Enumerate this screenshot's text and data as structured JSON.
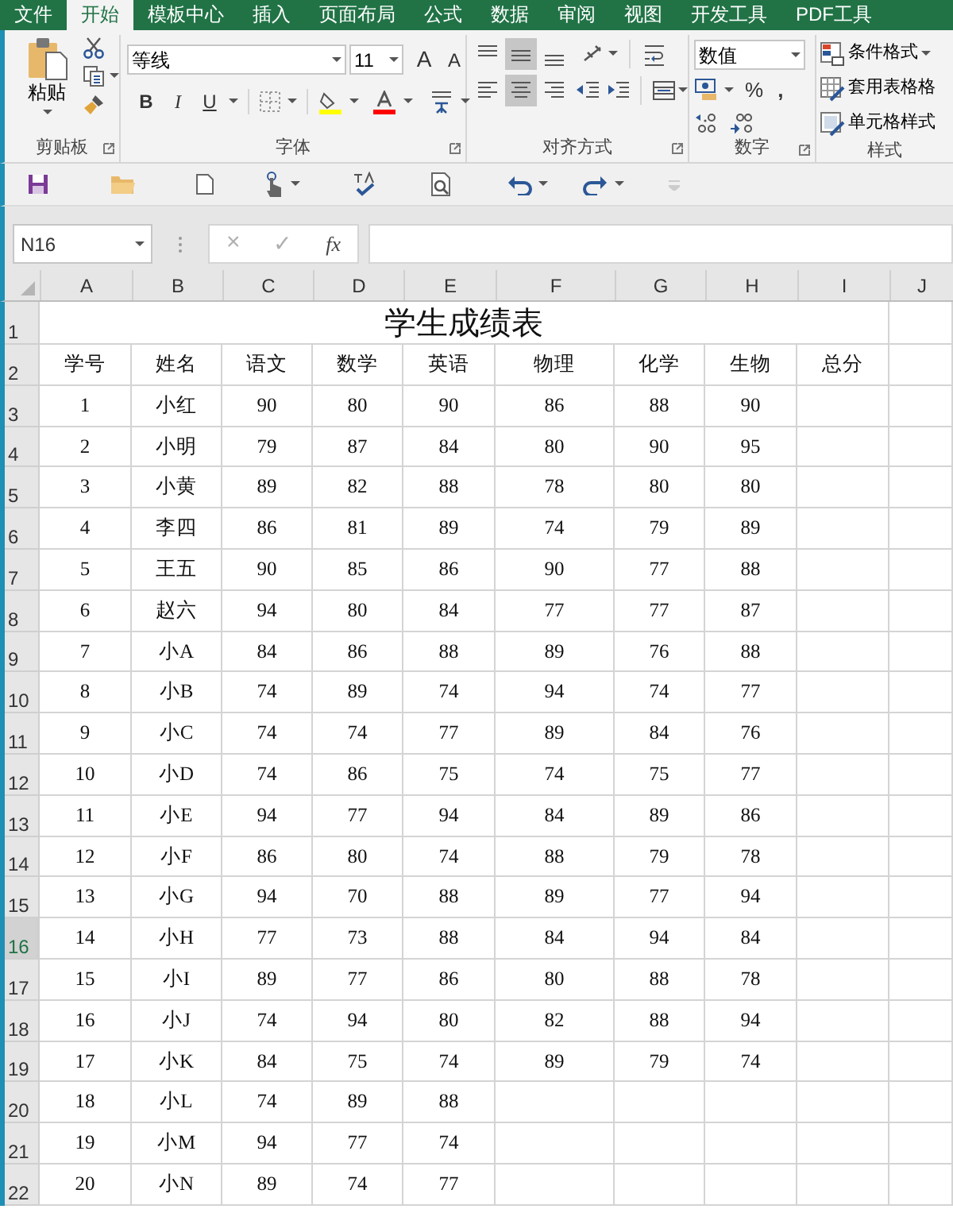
{
  "tabs": [
    {
      "label": "文件",
      "selected": false
    },
    {
      "label": "开始",
      "selected": true
    },
    {
      "label": "模板中心",
      "selected": false
    },
    {
      "label": "插入",
      "selected": false
    },
    {
      "label": "页面布局",
      "selected": false
    },
    {
      "label": "公式",
      "selected": false
    },
    {
      "label": "数据",
      "selected": false
    },
    {
      "label": "审阅",
      "selected": false
    },
    {
      "label": "视图",
      "selected": false
    },
    {
      "label": "开发工具",
      "selected": false
    },
    {
      "label": "PDF工具",
      "selected": false
    }
  ],
  "ribbon": {
    "clipboard": {
      "paste_label": "粘贴",
      "group_label": "剪贴板"
    },
    "font": {
      "font_name": "等线",
      "font_size": "11",
      "grow_label": "A",
      "shrink_label": "A",
      "style_buttons": [
        "B",
        "I",
        "U"
      ],
      "group_label": "字体"
    },
    "alignment": {
      "vertical_align": [
        {
          "selected": false
        },
        {
          "selected": true
        },
        {
          "selected": false
        }
      ],
      "horizontal_align": [
        {
          "selected": false
        },
        {
          "selected": true
        },
        {
          "selected": false
        }
      ],
      "group_label": "对齐方式"
    },
    "number": {
      "format": "数值",
      "percent": "%",
      "comma": ",",
      "group_label": "数字"
    },
    "styles": {
      "items": [
        "条件格式",
        "套用表格格",
        "单元格样式"
      ],
      "group_label": "样式"
    }
  },
  "formula_bar": {
    "name_box": "N16",
    "cancel": "×",
    "enter": "✓",
    "function": "fx"
  },
  "sheet": {
    "columns": [
      "A",
      "B",
      "C",
      "D",
      "E",
      "F",
      "G",
      "H",
      "I",
      "J"
    ],
    "rows": [
      {
        "number": "1",
        "selected": false,
        "kind": "title",
        "title": "学生成绩表"
      },
      {
        "number": "2",
        "selected": false,
        "kind": "header",
        "cells": [
          "学号",
          "姓名",
          "语文",
          "数学",
          "英语",
          "物理",
          "化学",
          "生物",
          "总分"
        ]
      },
      {
        "number": "3",
        "selected": false,
        "kind": "data",
        "cells": [
          "1",
          "小红",
          "90",
          "80",
          "90",
          "86",
          "88",
          "90"
        ]
      },
      {
        "number": "4",
        "selected": false,
        "kind": "data",
        "cells": [
          "2",
          "小明",
          "79",
          "87",
          "84",
          "80",
          "90",
          "95"
        ]
      },
      {
        "number": "5",
        "selected": false,
        "kind": "data",
        "cells": [
          "3",
          "小黄",
          "89",
          "82",
          "88",
          "78",
          "80",
          "80"
        ]
      },
      {
        "number": "6",
        "selected": false,
        "kind": "data",
        "cells": [
          "4",
          "李四",
          "86",
          "81",
          "89",
          "74",
          "79",
          "89"
        ]
      },
      {
        "number": "7",
        "selected": false,
        "kind": "data",
        "cells": [
          "5",
          "王五",
          "90",
          "85",
          "86",
          "90",
          "77",
          "88"
        ]
      },
      {
        "number": "8",
        "selected": false,
        "kind": "data",
        "cells": [
          "6",
          "赵六",
          "94",
          "80",
          "84",
          "77",
          "77",
          "87"
        ]
      },
      {
        "number": "9",
        "selected": false,
        "kind": "data",
        "cells": [
          "7",
          "小A",
          "84",
          "86",
          "88",
          "89",
          "76",
          "88"
        ]
      },
      {
        "number": "10",
        "selected": false,
        "kind": "data",
        "cells": [
          "8",
          "小B",
          "74",
          "89",
          "74",
          "94",
          "74",
          "77"
        ]
      },
      {
        "number": "11",
        "selected": false,
        "kind": "data",
        "cells": [
          "9",
          "小C",
          "74",
          "74",
          "77",
          "89",
          "84",
          "76"
        ]
      },
      {
        "number": "12",
        "selected": false,
        "kind": "data",
        "cells": [
          "10",
          "小D",
          "74",
          "86",
          "75",
          "74",
          "75",
          "77"
        ]
      },
      {
        "number": "13",
        "selected": false,
        "kind": "data",
        "cells": [
          "11",
          "小E",
          "94",
          "77",
          "94",
          "84",
          "89",
          "86"
        ]
      },
      {
        "number": "14",
        "selected": false,
        "kind": "data",
        "cells": [
          "12",
          "小F",
          "86",
          "80",
          "74",
          "88",
          "79",
          "78"
        ]
      },
      {
        "number": "15",
        "selected": false,
        "kind": "data",
        "cells": [
          "13",
          "小G",
          "94",
          "70",
          "88",
          "89",
          "77",
          "94"
        ]
      },
      {
        "number": "16",
        "selected": true,
        "kind": "data",
        "cells": [
          "14",
          "小H",
          "77",
          "73",
          "88",
          "84",
          "94",
          "84"
        ]
      },
      {
        "number": "17",
        "selected": false,
        "kind": "data",
        "cells": [
          "15",
          "小I",
          "89",
          "77",
          "86",
          "80",
          "88",
          "78"
        ]
      },
      {
        "number": "18",
        "selected": false,
        "kind": "data",
        "cells": [
          "16",
          "小J",
          "74",
          "94",
          "80",
          "82",
          "88",
          "94"
        ]
      },
      {
        "number": "19",
        "selected": false,
        "kind": "data",
        "cells": [
          "17",
          "小K",
          "84",
          "75",
          "74",
          "89",
          "79",
          "74"
        ]
      },
      {
        "number": "20",
        "selected": false,
        "kind": "data",
        "cells": [
          "18",
          "小L",
          "74",
          "89",
          "88"
        ]
      },
      {
        "number": "21",
        "selected": false,
        "kind": "data",
        "cells": [
          "19",
          "小M",
          "94",
          "77",
          "74"
        ]
      },
      {
        "number": "22",
        "selected": false,
        "kind": "data",
        "cells": [
          "20",
          "小N",
          "89",
          "74",
          "77"
        ]
      }
    ]
  }
}
